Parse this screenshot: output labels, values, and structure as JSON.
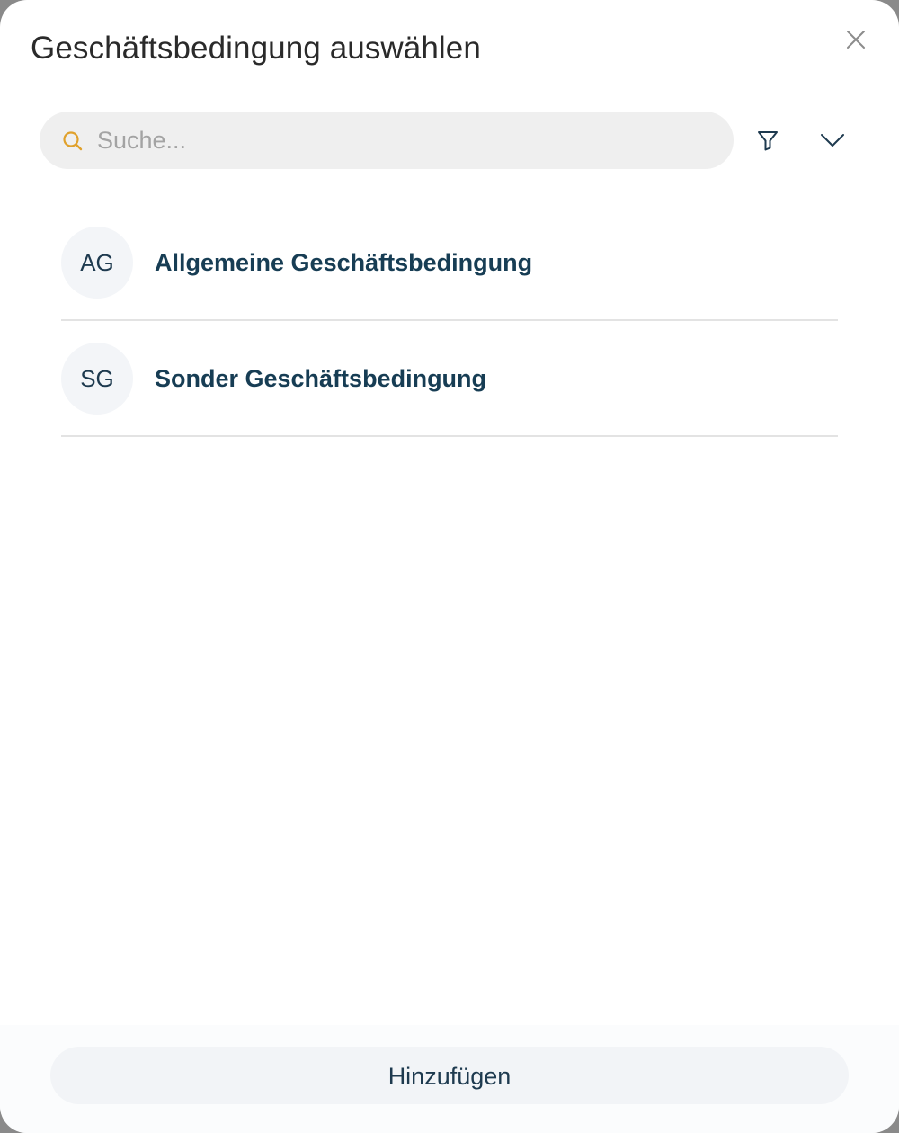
{
  "dialog": {
    "title": "Geschäftsbedingung auswählen"
  },
  "search": {
    "placeholder": "Suche...",
    "value": ""
  },
  "list": {
    "items": [
      {
        "initials": "AG",
        "label": "Allgemeine Geschäftsbedingung"
      },
      {
        "initials": "SG",
        "label": "Sonder Geschäftsbedingung"
      }
    ]
  },
  "footer": {
    "add_label": "Hinzufügen"
  },
  "colors": {
    "accent_search_icon": "#e0a12c",
    "text_primary": "#173d54",
    "search_background": "#efefef"
  },
  "icons": {
    "close": "close-icon",
    "search": "search-icon",
    "filter": "filter-icon",
    "expand": "chevron-down-icon"
  }
}
